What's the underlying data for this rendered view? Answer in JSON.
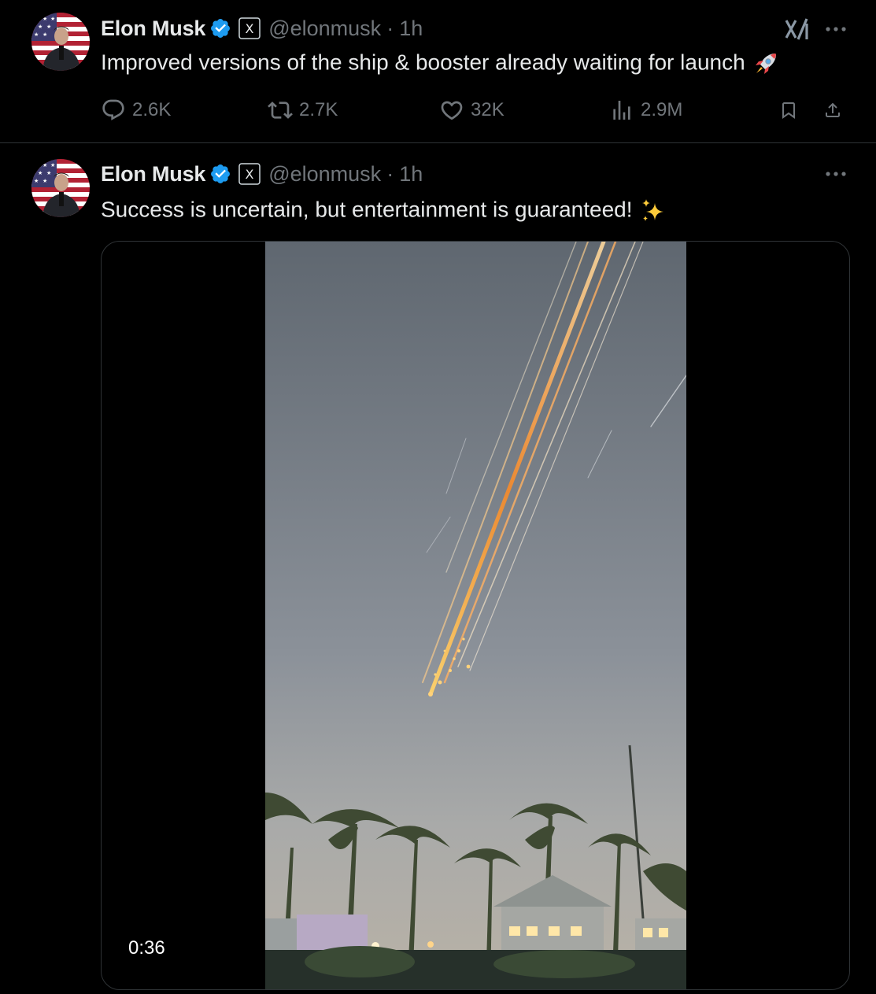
{
  "tweets": [
    {
      "author": {
        "name": "Elon Musk",
        "handle": "@elonmusk",
        "affiliate": "X"
      },
      "time": "1h",
      "text": "Improved versions of the ship & booster already waiting for launch",
      "emoji": "rocket-icon",
      "stats": {
        "replies": "2.6K",
        "reposts": "2.7K",
        "likes": "32K",
        "views": "2.9M"
      }
    },
    {
      "author": {
        "name": "Elon Musk",
        "handle": "@elonmusk",
        "affiliate": "X"
      },
      "time": "1h",
      "text": "Success is uncertain, but entertainment is guaranteed!",
      "emoji": "sparkles-icon",
      "media": {
        "type": "video",
        "duration": "0:36"
      }
    }
  ],
  "separator": "·",
  "colors": {
    "background": "#000000",
    "text": "#e7e9ea",
    "muted": "#71767b",
    "verified": "#1d9bf0",
    "divider": "#2f3336"
  }
}
